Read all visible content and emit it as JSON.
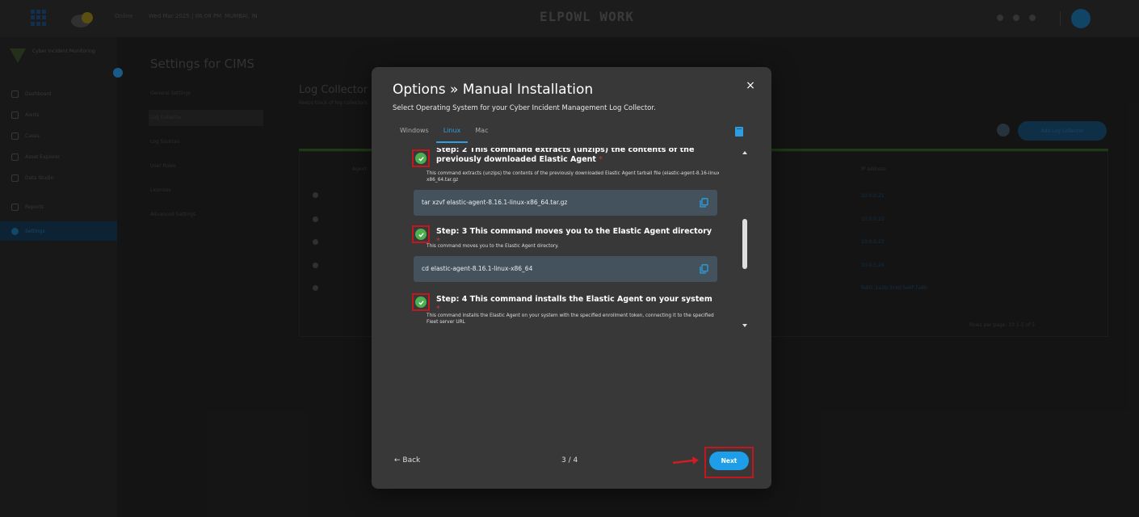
{
  "topbar": {
    "status_text": "Online",
    "datetime_text": "Wed Mar 2025  |  06:08 PM",
    "location_text": "MUMBAI, IN",
    "logo_text": "ELPOWL WORK"
  },
  "sidebar": {
    "title": "Cyber Incident Monitoring",
    "items": [
      {
        "label": "Dashboard"
      },
      {
        "label": "Alerts"
      },
      {
        "label": "Cases"
      },
      {
        "label": "Asset Explorer"
      },
      {
        "label": "Data Studio"
      },
      {
        "label": "Reports"
      },
      {
        "label": "Settings"
      }
    ]
  },
  "settings": {
    "title": "Settings for CIMS",
    "subnav": [
      "General Settings",
      "Log Collector",
      "Log Sources",
      "User Roles",
      "Licenses",
      "Advanced Settings"
    ],
    "log_collector_title": "Log Collector",
    "log_collector_sub": "Keeps track of log collectors",
    "add_button": "Add Log Collector",
    "table_headers": [
      "Agent",
      "IP address"
    ],
    "ip_values": [
      "10.0.0.21",
      "10.0.0.22",
      "10.0.0.23",
      "10.0.0.24",
      "fe80::1a2b:3c4d:5e6f:7a8b"
    ],
    "pagination": "Rows per page: 10    1-5 of 5"
  },
  "modal": {
    "title": "Options » Manual Installation",
    "subtitle": "Select Operating System for your Cyber Incident Management Log Collector.",
    "tabs": [
      {
        "label": "Windows",
        "active": false
      },
      {
        "label": "Linux",
        "active": true
      },
      {
        "label": "Mac",
        "active": false
      }
    ],
    "steps": [
      {
        "title": "Step: 2 This command extracts (unzips) the contents of the previously downloaded Elastic Agent",
        "required": "*",
        "description": "This command extracts (unzips) the contents of the previously downloaded Elastic Agent tarball file (elastic-agent-8.16-linux-x86_64.tar.gz",
        "code": "tar xzvf elastic-agent-8.16.1-linux-x86_64.tar.gz"
      },
      {
        "title": "Step: 3 This command moves you to the Elastic Agent directory",
        "required": "*",
        "description": "This command moves you to the Elastic Agent directory.",
        "code": "cd elastic-agent-8.16.1-linux-x86_64"
      },
      {
        "title": "Step: 4 This command installs the Elastic Agent on your system",
        "required": "*",
        "description": "This command installs the Elastic Agent on your system with the specified enrollment token, connecting it to the specified Fleet server URL"
      }
    ],
    "back_label": "← Back",
    "page_indicator": "3 / 4",
    "next_label": "Next",
    "close_glyph": "×"
  },
  "colors": {
    "accent": "#1e9ee8",
    "check_green": "#4caf50",
    "highlight_red": "#c0181e"
  }
}
